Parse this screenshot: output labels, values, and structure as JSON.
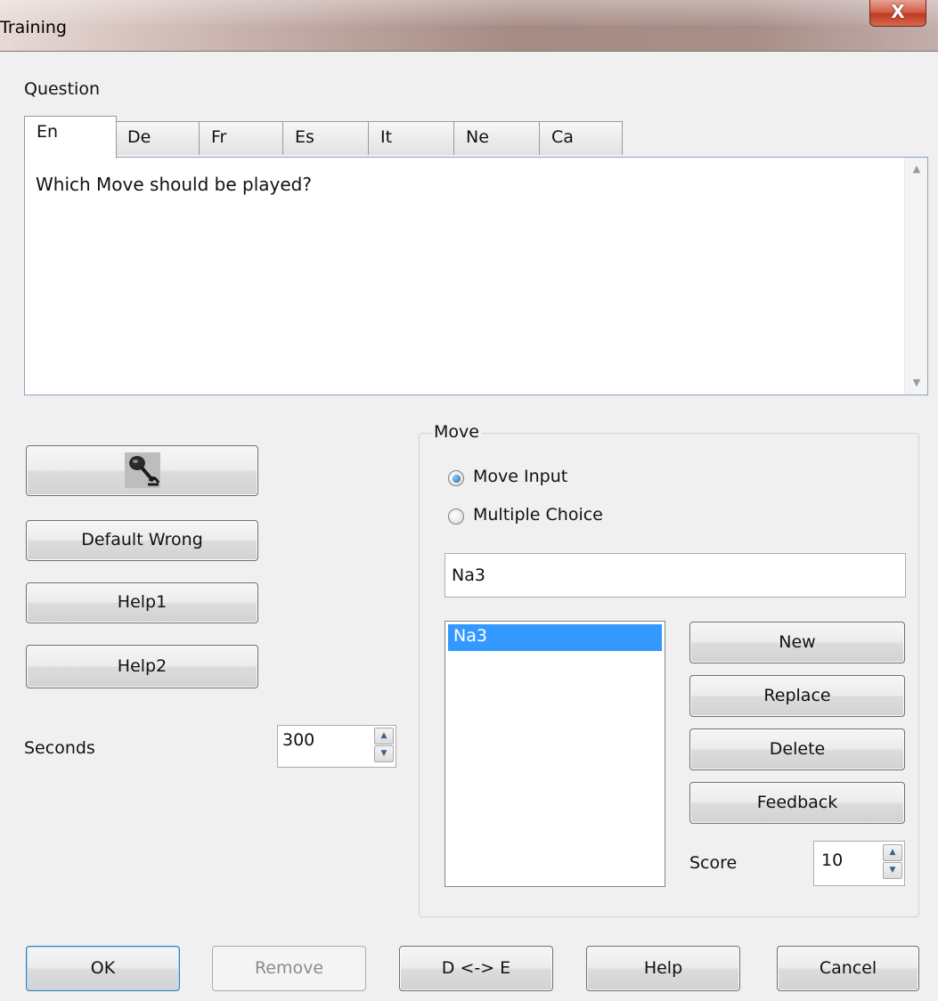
{
  "window": {
    "title": "Training",
    "close_glyph": "X"
  },
  "question": {
    "label": "Question",
    "tabs": [
      "En",
      "De",
      "Fr",
      "Es",
      "It",
      "Ne",
      "Ca"
    ],
    "active_tab": "En",
    "text": "Which Move should be played?"
  },
  "left_buttons": {
    "mic_icon": "microphone-icon",
    "default_wrong": "Default Wrong",
    "help1": "Help1",
    "help2": "Help2"
  },
  "seconds": {
    "label": "Seconds",
    "value": "300"
  },
  "move": {
    "group_label": "Move",
    "radio_move_input": "Move Input",
    "radio_multiple_choice": "Multiple Choice",
    "selected_option": "Move Input",
    "input_value": "Na3",
    "list_items": [
      "Na3"
    ],
    "buttons": {
      "new": "New",
      "replace": "Replace",
      "delete": "Delete",
      "feedback": "Feedback"
    },
    "score_label": "Score",
    "score_value": "10"
  },
  "footer": {
    "ok": "OK",
    "remove": "Remove",
    "swap": "D <-> E",
    "help": "Help",
    "cancel": "Cancel"
  },
  "colors": {
    "selection": "#3399ff",
    "default_button_border": "#3c7fb1"
  }
}
